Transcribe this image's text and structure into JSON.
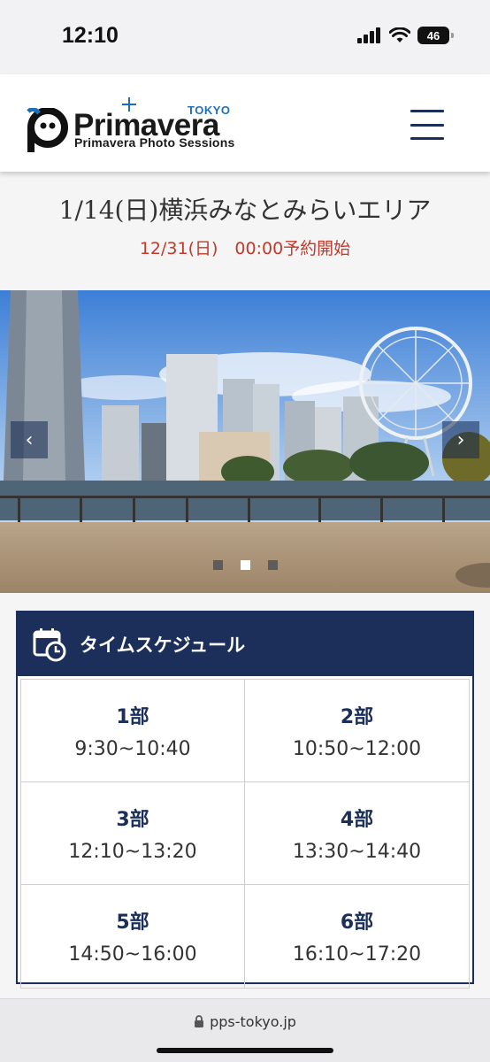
{
  "status_bar": {
    "time": "12:10",
    "battery": "46"
  },
  "header": {
    "logo_title": "Primavera",
    "logo_tokyo": "TOKYO",
    "logo_subtitle": "Primavera Photo Sessions"
  },
  "event": {
    "title": "1/14(日)横浜みなとみらいエリア",
    "booking_start": "12/31(日)　00:00予約開始"
  },
  "slider": {
    "prev_label": "‹",
    "next_label": "›",
    "slide_count": 3,
    "active_slide": 2
  },
  "schedule": {
    "heading": "タイムスケジュール",
    "slots": [
      {
        "part": "1部",
        "time": "9:30~10:40"
      },
      {
        "part": "2部",
        "time": "10:50~12:00"
      },
      {
        "part": "3部",
        "time": "12:10~13:20"
      },
      {
        "part": "4部",
        "time": "13:30~14:40"
      },
      {
        "part": "5部",
        "time": "14:50~16:00"
      },
      {
        "part": "6部",
        "time": "16:10~17:20"
      }
    ]
  },
  "browser": {
    "url": "pps-tokyo.jp"
  },
  "colors": {
    "navy": "#1b2f5a",
    "accent_red": "#c0392b",
    "logo_blue": "#1f6fb8"
  }
}
